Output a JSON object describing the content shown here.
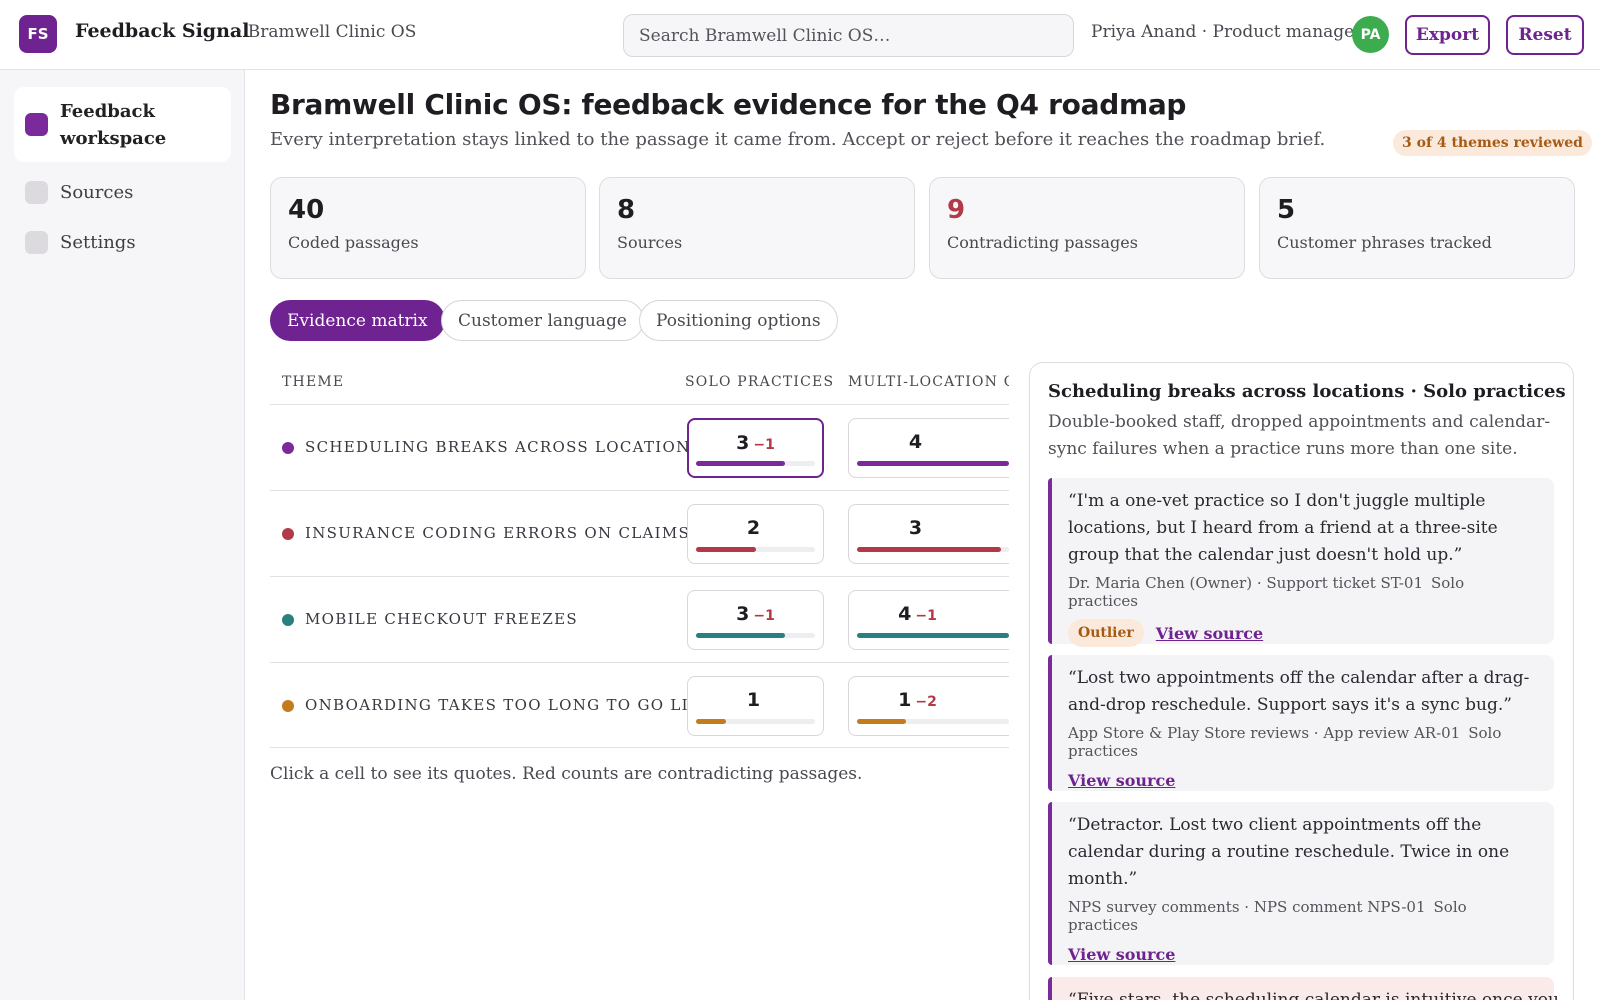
{
  "header": {
    "logo_initials": "FS",
    "app_name": "Feedback Signal",
    "workspace_crumb": "· Bramwell Clinic OS",
    "search_placeholder": "Search Bramwell Clinic OS…",
    "user_label": "Priya Anand · Product manager",
    "avatar_initials": "PA",
    "export_label": "Export",
    "reset_label": "Reset"
  },
  "sidebar": {
    "items": [
      {
        "label": "Feedback workspace",
        "active": true
      },
      {
        "label": "Sources",
        "active": false
      },
      {
        "label": "Settings",
        "active": false
      }
    ]
  },
  "page": {
    "title": "Bramwell Clinic OS: feedback evidence for the Q4 roadmap",
    "subtitle": "Every interpretation stays linked to the passage it came from. Accept or reject before it reaches the roadmap brief.",
    "review_badge": "3 of 4 themes reviewed"
  },
  "stats": [
    {
      "value": "40",
      "label": "Coded passages"
    },
    {
      "value": "8",
      "label": "Sources"
    },
    {
      "value": "9",
      "label": "Contradicting passages"
    },
    {
      "value": "5",
      "label": "Customer phrases tracked"
    }
  ],
  "tabs": [
    {
      "label": "Evidence matrix",
      "active": true
    },
    {
      "label": "Customer language",
      "active": false
    },
    {
      "label": "Positioning options",
      "active": false
    }
  ],
  "matrix": {
    "columns": [
      "THEME",
      "SOLO PRACTICES",
      "MULTI-LOCATION G"
    ],
    "rows": [
      {
        "theme": "SCHEDULING BREAKS ACROSS LOCATIONS",
        "color": "#7a2a9a",
        "cells": [
          {
            "count": "3",
            "contra": "−1",
            "fill": 0.75,
            "selected": true
          },
          {
            "count": "4",
            "contra": "",
            "fill": 1.0
          }
        ]
      },
      {
        "theme": "INSURANCE CODING ERRORS ON CLAIMS",
        "color": "#b23a48",
        "cells": [
          {
            "count": "2",
            "contra": "",
            "fill": 0.5
          },
          {
            "count": "3",
            "contra": "",
            "fill": 0.95
          }
        ]
      },
      {
        "theme": "MOBILE CHECKOUT FREEZES",
        "color": "#2a7f7f",
        "cells": [
          {
            "count": "3",
            "contra": "−1",
            "fill": 0.75
          },
          {
            "count": "4",
            "contra": "−1",
            "fill": 1.0
          }
        ]
      },
      {
        "theme": "ONBOARDING TAKES TOO LONG TO GO LIVE",
        "color": "#c27b1f",
        "cells": [
          {
            "count": "1",
            "contra": "",
            "fill": 0.25
          },
          {
            "count": "1",
            "contra": "−2",
            "fill": 0.32
          }
        ]
      }
    ],
    "hint": "Click a cell to see its quotes. Red counts are contradicting passages."
  },
  "detail": {
    "title": "Scheduling breaks across locations · Solo practices",
    "description": "Double-booked staff, dropped appointments and calendar-sync failures when a practice runs more than one site.",
    "quotes": [
      {
        "text": "“I'm a one-vet practice so I don't juggle multiple locations, but I heard from a friend at a three-site group that the calendar just doesn't hold up.”",
        "source": "Dr. Maria Chen (Owner) · Support ticket ST-01",
        "segment": "Solo practices",
        "badge": "Outlier",
        "link": "View source"
      },
      {
        "text": "“Lost two appointments off the calendar after a drag-and-drop reschedule. Support says it's a sync bug.”",
        "source": "App Store & Play Store reviews · App review AR-01",
        "segment": "Solo practices",
        "badge": "",
        "link": "View source"
      },
      {
        "text": "“Detractor. Lost two client appointments off the calendar during a routine reschedule. Twice in one month.”",
        "source": "NPS survey comments · NPS comment NPS-01",
        "segment": "Solo practices",
        "badge": "",
        "link": "View source"
      },
      {
        "text": "“Five stars, the scheduling calendar is intuitive once you",
        "source": "",
        "segment": "",
        "badge": "",
        "link": ""
      }
    ]
  }
}
